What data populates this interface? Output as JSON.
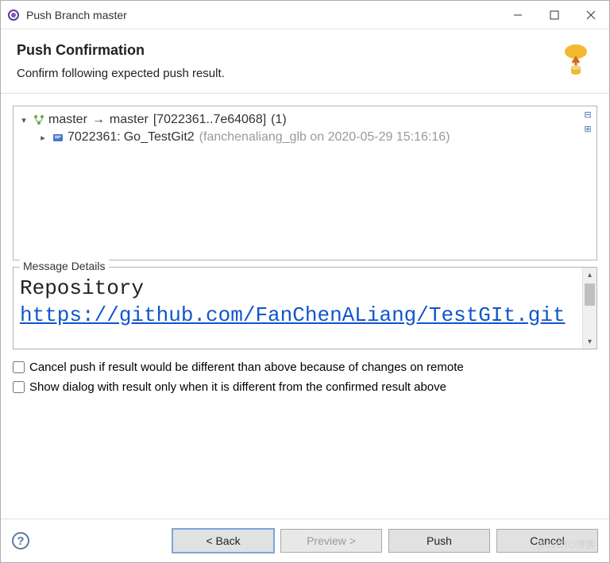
{
  "window": {
    "title": "Push Branch master"
  },
  "header": {
    "title": "Push Confirmation",
    "subtitle": "Confirm following expected push result."
  },
  "tree": {
    "root": {
      "local": "master",
      "remote": "master",
      "range": "[7022361..7e64068]",
      "count": "(1)"
    },
    "child": {
      "hash": "7022361:",
      "msg": "Go_TestGit2",
      "meta": "(fanchenaliang_glb on 2020-05-29 15:16:16)"
    }
  },
  "msg": {
    "label": "Message Details",
    "line1": "Repository",
    "url": "https://github.com/FanChenALiang/TestGIt.git"
  },
  "checks": {
    "cancel_diff": "Cancel push if result would be different than above because of changes on remote",
    "show_dialog": "Show dialog with result only when it is different from the confirmed result above"
  },
  "buttons": {
    "back": "< Back",
    "preview": "Preview >",
    "push": "Push",
    "cancel": "Cancel"
  },
  "watermark": "@51CTO博客"
}
